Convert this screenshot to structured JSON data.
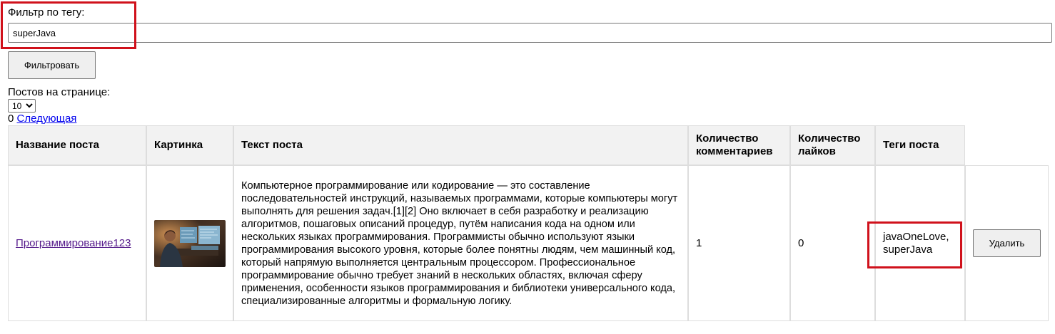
{
  "filter": {
    "label": "Фильтр по тегу:",
    "value": "superJava",
    "button_label": "Фильтровать"
  },
  "pagination": {
    "per_page_label": "Постов на странице:",
    "per_page_value": "10",
    "current_page": "0",
    "next_label": "Следующая"
  },
  "table": {
    "headers": {
      "title": "Название поста",
      "image": "Картинка",
      "text": "Текст поста",
      "comments": "Количество комментариев",
      "likes": "Количество лайков",
      "tags": "Теги поста"
    },
    "rows": [
      {
        "title": "Программирование123",
        "image_icon": "programmer-photo",
        "text": "Компьютерное программирование или кодирование — это составление последовательностей инструкций, называемых программами, которые компьютеры могут выполнять для решения задач.[1][2] Оно включает в себя разработку и реализацию алгоритмов, пошаговых описаний процедур, путём написания кода на одном или нескольких языках программирования. Программисты обычно используют языки программирования высокого уровня, которые более понятны людям, чем машинный код, который напрямую выполняется центральным процессором. Профессиональное программирование обычно требует знаний в нескольких областях, включая сферу применения, особенности языков программирования и библиотеки универсального кода, специализированные алгоритмы и формальную логику.",
        "comments": "1",
        "likes": "0",
        "tags": "javaOneLove, superJava",
        "delete_label": "Удалить"
      }
    ]
  },
  "colors": {
    "highlight": "#d0111b",
    "link": "#0000ee",
    "visited_link": "#551a8b",
    "header_bg": "#f2f2f2"
  }
}
